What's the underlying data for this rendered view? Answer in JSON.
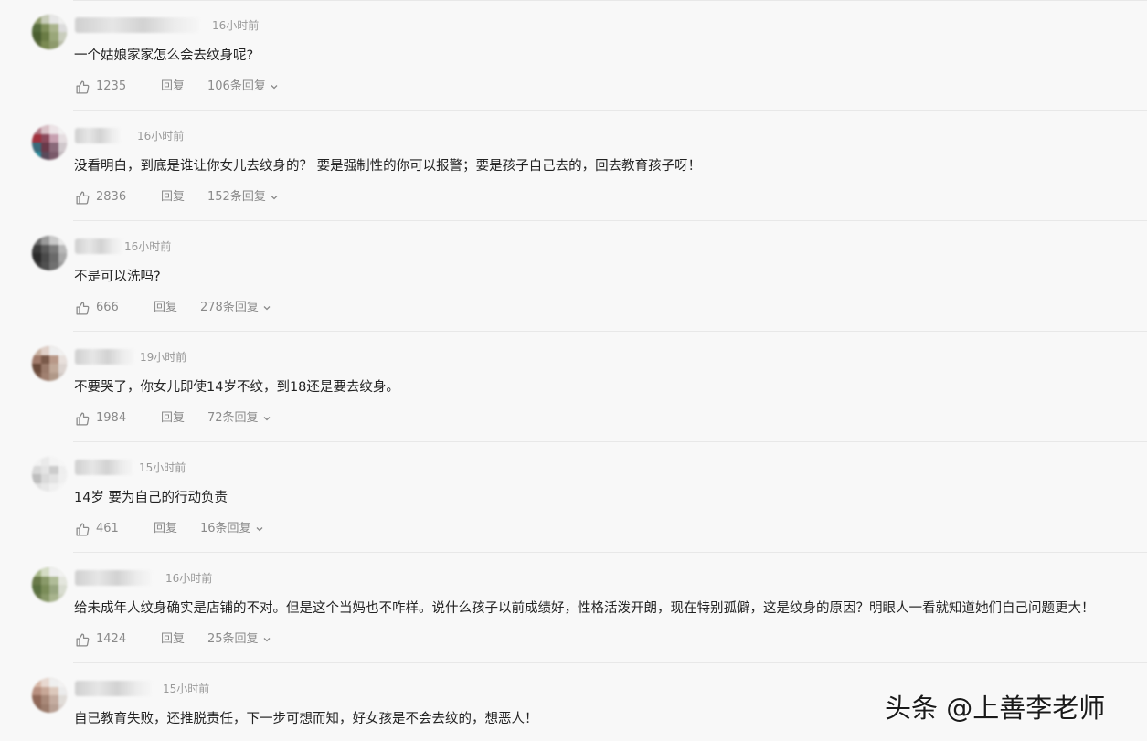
{
  "comments": [
    {
      "time": "16小时前",
      "text": "一个姑娘家家怎么会去纹身呢?",
      "likes": "1235",
      "reply_label": "回复",
      "replies": "106条回复"
    },
    {
      "time": "16小时前",
      "text": "没看明白，到底是谁让你女儿去纹身的？ 要是强制性的你可以报警；要是孩子自己去的，回去教育孩子呀！",
      "likes": "2836",
      "reply_label": "回复",
      "replies": "152条回复"
    },
    {
      "time": "16小时前",
      "text": "不是可以洗吗?",
      "likes": "666",
      "reply_label": "回复",
      "replies": "278条回复"
    },
    {
      "time": "19小时前",
      "text": "不要哭了，你女儿即使14岁不纹，到18还是要去纹身。",
      "likes": "1984",
      "reply_label": "回复",
      "replies": "72条回复"
    },
    {
      "time": "15小时前",
      "text": "14岁 要为自己的行动负责",
      "likes": "461",
      "reply_label": "回复",
      "replies": "16条回复"
    },
    {
      "time": "16小时前",
      "text": "给未成年人纹身确实是店铺的不对。但是这个当妈也不咋样。说什么孩子以前成绩好，性格活泼开朗，现在特别孤僻，这是纹身的原因？明眼人一看就知道她们自己问题更大！",
      "likes": "1424",
      "reply_label": "回复",
      "replies": "25条回复"
    },
    {
      "time": "15小时前",
      "text": "自已教育失败，还推脱责任，下一步可想而知，好女孩是不会去纹的，想恶人！",
      "likes": "",
      "reply_label": "",
      "replies": ""
    }
  ],
  "watermark": "头条 @上善李老师",
  "icons": {
    "like": "thumbs-up-icon",
    "expand": "chevron-down-icon"
  },
  "colors": {
    "background": "#f8f8f8",
    "text": "#222222",
    "muted": "#999999",
    "divider": "#e8e8e8"
  }
}
